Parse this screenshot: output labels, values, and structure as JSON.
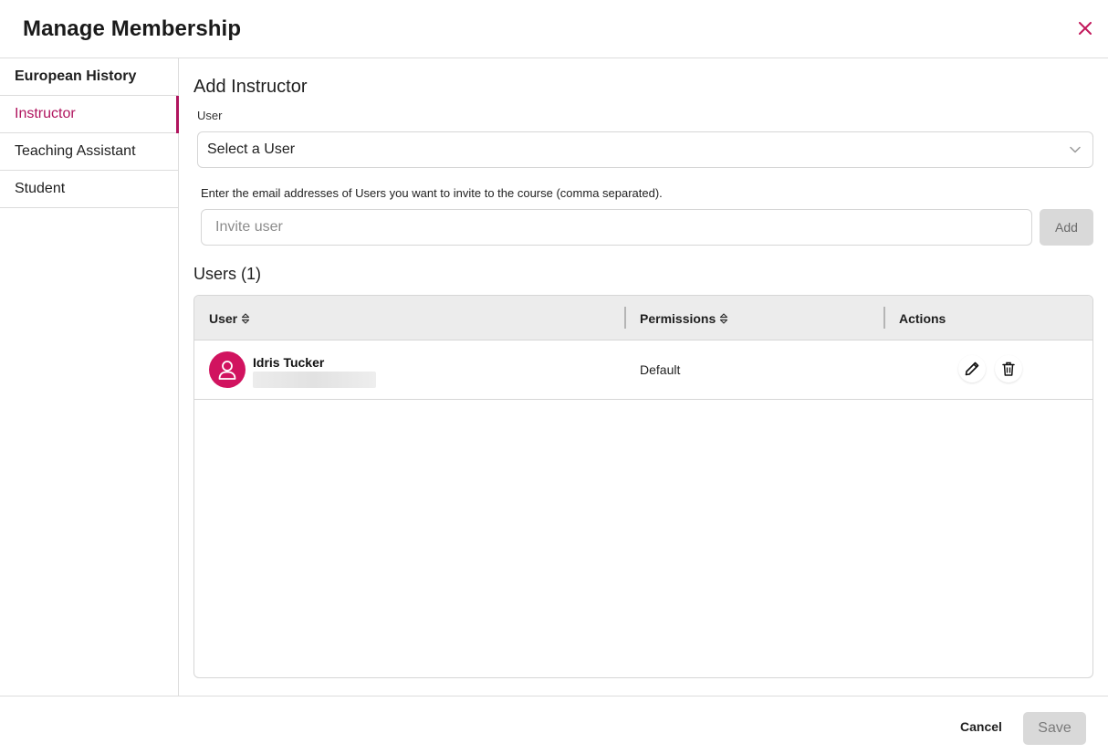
{
  "modal": {
    "title": "Manage Membership"
  },
  "sidebar": {
    "items": [
      {
        "label": "European History"
      },
      {
        "label": "Instructor"
      },
      {
        "label": "Teaching Assistant"
      },
      {
        "label": "Student"
      }
    ],
    "active": "Instructor"
  },
  "add_section": {
    "title": "Add Instructor",
    "user_label": "User",
    "select_value": "Select a User",
    "hint": "Enter the email addresses of Users you want to invite to the course (comma separated).",
    "invite_placeholder": "Invite user",
    "add_label": "Add"
  },
  "users": {
    "title": "Users (1)",
    "columns": [
      "User",
      "Permissions",
      "Actions"
    ],
    "rows": [
      {
        "name": "Idris Tucker",
        "permission": "Default"
      }
    ]
  },
  "footer": {
    "cancel_label": "Cancel",
    "save_label": "Save"
  },
  "colors": {
    "accent": "#b0145e",
    "avatar": "#d1135f",
    "close": "#c2185b",
    "disabled_button": "#d9d9d9"
  },
  "icons": {
    "close": "close-icon",
    "select": "chevron-down-icon",
    "sort": "sort-icon",
    "avatar": "user-icon",
    "edit": "pencil-icon",
    "delete": "trash-icon"
  }
}
